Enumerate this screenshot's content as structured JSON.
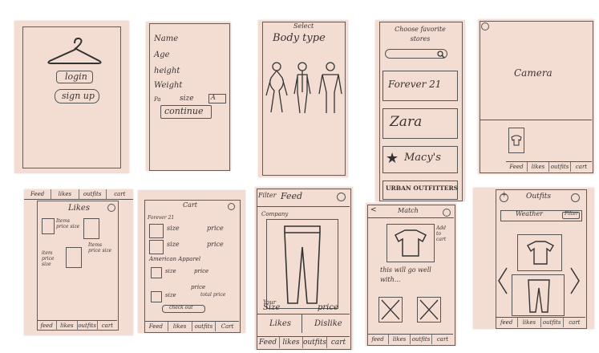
{
  "s1": {
    "login": "login",
    "signup": "sign up"
  },
  "s2": {
    "name": "Name",
    "age": "Age",
    "height": "height",
    "weight": "Weight",
    "size_prefix": "Pa",
    "size": "size",
    "size_box": "A",
    "continue": "continue"
  },
  "s3": {
    "select": "Select",
    "title": "Body type"
  },
  "s4": {
    "title": "Choose favorite stores",
    "stores": [
      "Forever 21",
      "Zara",
      "Macy's",
      "URBAN OUTFITTERS"
    ]
  },
  "s5": {
    "camera": "Camera",
    "nav": [
      "Feed",
      "likes",
      "outfits",
      "cart"
    ]
  },
  "s6": {
    "top_nav": [
      "Feed",
      "likes",
      "outfits",
      "cart"
    ],
    "title": "Likes",
    "item1": "Items price size",
    "item2": "item price size",
    "item3": "Items price size",
    "bottom_nav": [
      "feed",
      "likes",
      "outfits",
      "cart"
    ]
  },
  "s7": {
    "title": "Cart",
    "store1": "Forever 21",
    "store2": "American Apparel",
    "size": "size",
    "price": "price",
    "total": "total price",
    "checkout": "check out",
    "nav": [
      "Feed",
      "likes",
      "outfits",
      "Cart"
    ]
  },
  "s8": {
    "filter": "Filter",
    "feed": "Feed",
    "company": "Company",
    "your": "Your",
    "size": "Size",
    "price": "price",
    "likes": "Likes",
    "dislike": "Dislike",
    "nav": [
      "Feed",
      "likes",
      "outfits",
      "cart"
    ]
  },
  "s9": {
    "back": "<",
    "title": "Match",
    "add": "Add to cart",
    "caption": "this will go well with...",
    "nav": [
      "feed",
      "likes",
      "outfits",
      "cart"
    ]
  },
  "s10": {
    "add": "+",
    "title": "Outfits",
    "weather": "Weather",
    "filter": "Filter",
    "nav": [
      "feed",
      "likes",
      "outfits",
      "cart"
    ]
  }
}
